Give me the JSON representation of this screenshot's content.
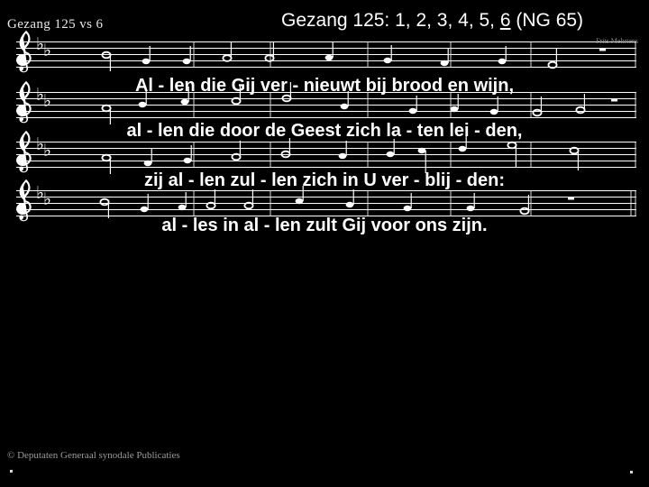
{
  "slide": {
    "background_color": "#000000",
    "text_color": "#ffffff",
    "title_prefix": "Gezang 125: 1, 2, 3, 4, 5, ",
    "title_verse": "6",
    "title_suffix": " (NG 65)",
    "title_full": "Gezang 125: 1, 2, 3, 4, 5, 6 (NG 65)"
  },
  "sheet": {
    "header": "Gezang 125  vs  6",
    "credit": "Frits Mehrtens",
    "key_signature": "two-flats",
    "clef": "treble-clef",
    "systems": 4
  },
  "lyrics": {
    "lines": [
      "Al - len   die   Gij   ver - nieuwt   bij   brood   en   wijn,",
      "al - len   die   door   de   Geest   zich   la - ten   lei - den,",
      "zij   al - len   zul - len   zich   in   U   ver - blij - den:",
      "al - les   in   al - len   zult   Gij   voor   ons   zijn."
    ]
  },
  "footer": {
    "copyright": "© Deputaten Generaal synodale Publicaties"
  }
}
